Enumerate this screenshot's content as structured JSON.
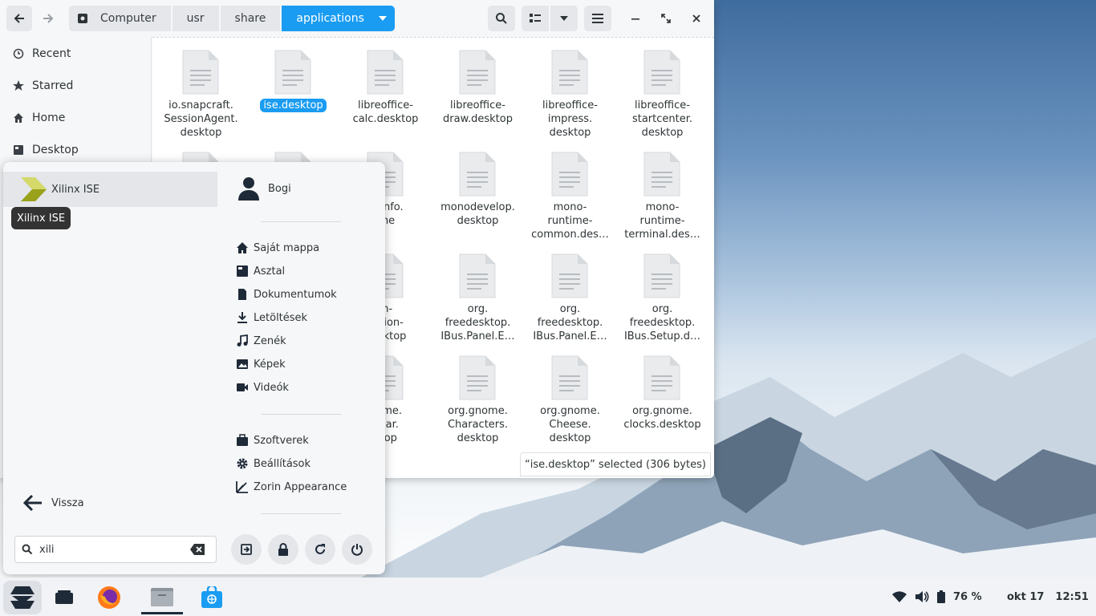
{
  "file_manager": {
    "breadcrumbs": [
      "Computer",
      "usr",
      "share",
      "applications"
    ],
    "sidebar": [
      {
        "label": "Recent",
        "icon": "clock-icon"
      },
      {
        "label": "Starred",
        "icon": "star-icon"
      },
      {
        "label": "Home",
        "icon": "home-icon"
      },
      {
        "label": "Desktop",
        "icon": "desktop-icon"
      }
    ],
    "files": [
      {
        "l1": "io.snapcraft.",
        "l2": "SessionAgent.",
        "l3": "desktop"
      },
      {
        "l1": "ise.desktop",
        "l2": "",
        "l3": ""
      },
      {
        "l1": "libreoffice-",
        "l2": "calc.desktop",
        "l3": ""
      },
      {
        "l1": "libreoffice-",
        "l2": "draw.desktop",
        "l3": ""
      },
      {
        "l1": "libreoffice-",
        "l2": "impress.",
        "l3": "desktop"
      },
      {
        "l1": "libreoffice-",
        "l2": "startcenter.",
        "l3": "desktop"
      },
      {
        "l1": "",
        "l2": "",
        "l3": ""
      },
      {
        "l1": "",
        "l2": "",
        "l3": ""
      },
      {
        "l1": "eeinfo.",
        "l2": "che",
        "l3": ""
      },
      {
        "l1": "monodevelop.",
        "l2": "desktop",
        "l3": ""
      },
      {
        "l1": "mono-",
        "l2": "runtime-",
        "l3": "common.des…"
      },
      {
        "l1": "mono-",
        "l2": "runtime-",
        "l3": "terminal.des…"
      },
      {
        "l1": "",
        "l2": "",
        "l3": ""
      },
      {
        "l1": "",
        "l2": "",
        "l3": ""
      },
      {
        "l1": "m-",
        "l2": "ection-",
        "l3": "desktop"
      },
      {
        "l1": "org.",
        "l2": "freedesktop.",
        "l3": "IBus.Panel.E…"
      },
      {
        "l1": "org.",
        "l2": "freedesktop.",
        "l3": "IBus.Panel.E…"
      },
      {
        "l1": "org.",
        "l2": "freedesktop.",
        "l3": "IBus.Setup.d…"
      },
      {
        "l1": "",
        "l2": "",
        "l3": ""
      },
      {
        "l1": "",
        "l2": "",
        "l3": ""
      },
      {
        "l1": "nome.",
        "l2": "ndar.",
        "l3": "ktop"
      },
      {
        "l1": "org.gnome.",
        "l2": "Characters.",
        "l3": "desktop"
      },
      {
        "l1": "org.gnome.",
        "l2": "Cheese.",
        "l3": "desktop"
      },
      {
        "l1": "org.gnome.",
        "l2": "clocks.desktop",
        "l3": ""
      }
    ],
    "status": "“ise.desktop” selected  (306 bytes)"
  },
  "menu": {
    "result": "Xilinx ISE",
    "tooltip": "Xilinx ISE",
    "user": "Bogi",
    "places": [
      {
        "label": "Saját mappa",
        "icon": "home-icon"
      },
      {
        "label": "Asztal",
        "icon": "desktop-icon"
      },
      {
        "label": "Dokumentumok",
        "icon": "document-icon"
      },
      {
        "label": "Letöltések",
        "icon": "download-icon"
      },
      {
        "label": "Zenék",
        "icon": "music-icon"
      },
      {
        "label": "Képek",
        "icon": "picture-icon"
      },
      {
        "label": "Videók",
        "icon": "video-icon"
      }
    ],
    "system": [
      {
        "label": "Szoftverek",
        "icon": "software-icon"
      },
      {
        "label": "Beállítások",
        "icon": "settings-icon"
      },
      {
        "label": "Zorin Appearance",
        "icon": "appearance-icon"
      }
    ],
    "back": "Vissza",
    "search_value": "xili"
  },
  "taskbar": {
    "battery": "76 %",
    "date": "okt 17",
    "time": "12:51"
  },
  "colors": {
    "accent": "#1a9cf2"
  }
}
